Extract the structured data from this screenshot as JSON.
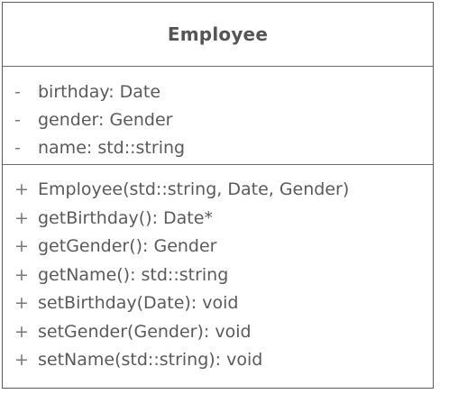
{
  "class_name": "Employee",
  "attributes": [
    {
      "visibility": "-",
      "signature": "birthday: Date"
    },
    {
      "visibility": "-",
      "signature": "gender: Gender"
    },
    {
      "visibility": "-",
      "signature": "name: std::string"
    }
  ],
  "operations": [
    {
      "visibility": "+",
      "signature": "Employee(std::string, Date, Gender)"
    },
    {
      "visibility": "+",
      "signature": "getBirthday(): Date*"
    },
    {
      "visibility": "+",
      "signature": "getGender(): Gender"
    },
    {
      "visibility": "+",
      "signature": "getName(): std::string"
    },
    {
      "visibility": "+",
      "signature": "setBirthday(Date): void"
    },
    {
      "visibility": "+",
      "signature": "setGender(Gender): void"
    },
    {
      "visibility": "+",
      "signature": "setName(std::string): void"
    }
  ]
}
